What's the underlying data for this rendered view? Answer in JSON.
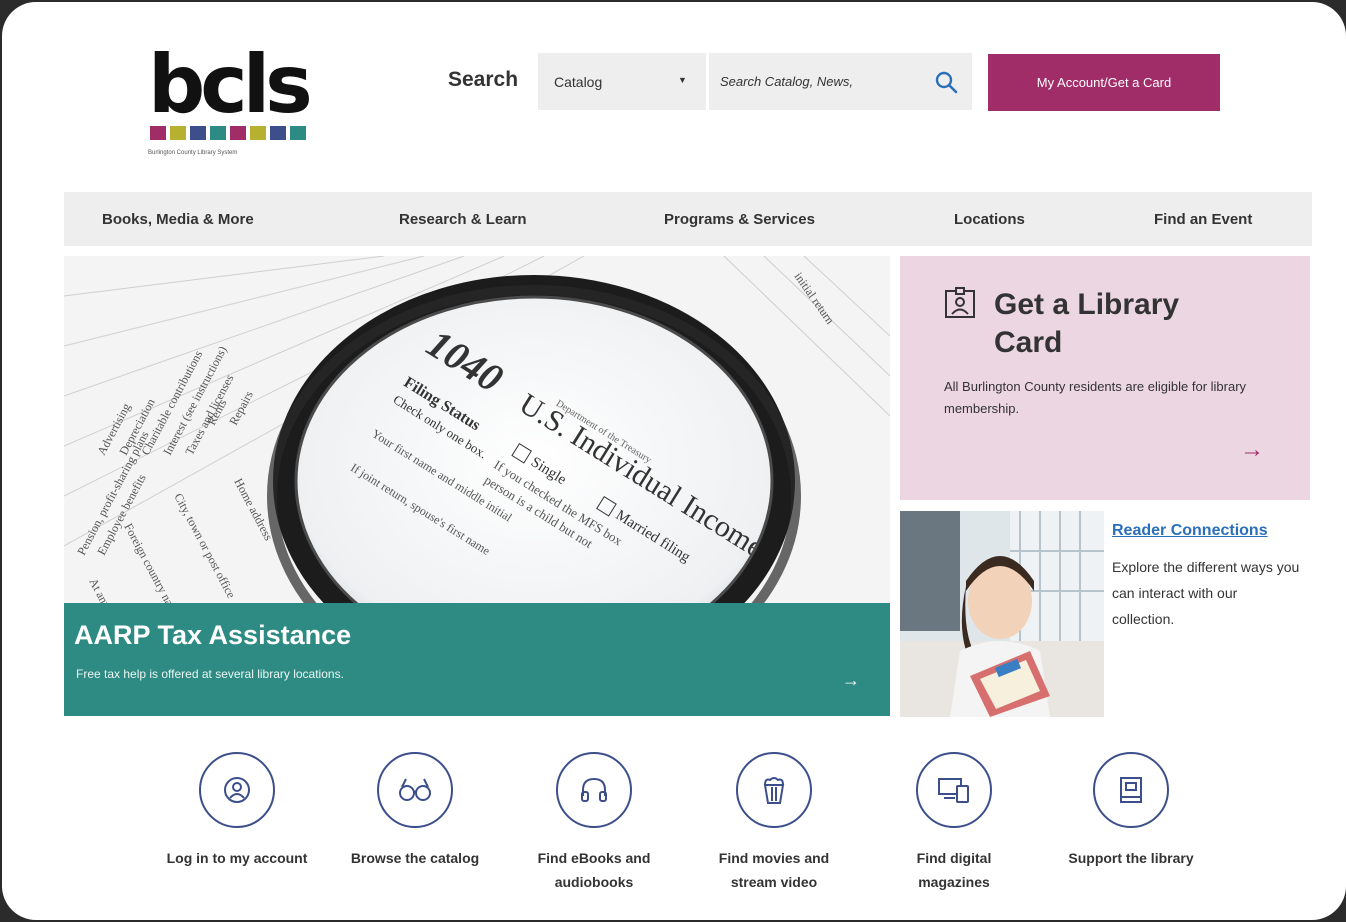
{
  "logo": {
    "word": "bcls",
    "tagline": "Burlington County Library System",
    "square_colors": [
      "#a02c68",
      "#b6b131",
      "#3c4f8a",
      "#2e8b83",
      "#a02c68",
      "#b6b131",
      "#3c4f8a",
      "#2e8b83"
    ]
  },
  "search": {
    "label": "Search",
    "scope_selected": "Catalog",
    "placeholder": "Search Catalog, News,",
    "icon": "magnifier-icon"
  },
  "account_button": {
    "label": "My Account/Get a Card"
  },
  "nav": {
    "items": [
      {
        "label": "Books, Media & More"
      },
      {
        "label": "Research & Learn"
      },
      {
        "label": "Programs & Services"
      },
      {
        "label": "Locations"
      },
      {
        "label": "Find an Event"
      }
    ]
  },
  "hero": {
    "title": "AARP Tax Assistance",
    "subtitle": "Free tax help is offered at several library locations.",
    "arrow": "→",
    "form_number": "1040",
    "form_title": "U.S. Individual Income",
    "filing_status": "Filing Status",
    "check_only": "Check only one box.",
    "single": "Single",
    "married": "Married filing",
    "first_name": "Your first name and middle initial",
    "if_checked": "If you checked the MFS box",
    "a_child": "person is a child but not",
    "joint_return": "If joint return, spouse's first name",
    "home_address": "Home address",
    "city": "City, town or post office",
    "foreign": "Foreign country name",
    "at_any": "At any time",
    "treasury": "Department of the Treasury",
    "form_margin": [
      "Advertising",
      "Depreciation",
      "Charitable contributions",
      "Interest (see instructions)",
      "Taxes and licenses",
      "Rents",
      "Repairs",
      "Pension, profit-sharing plans",
      "Employee benefits"
    ],
    "initial_return": "initial return",
    "color": "#2e8b83"
  },
  "card": {
    "title": "Get a Library Card",
    "body": "All Burlington County residents are eligible for library membership.",
    "arrow": "→",
    "icon": "id-badge-icon",
    "background": "#ecd6e1"
  },
  "reader_connections": {
    "title": "Reader Connections",
    "body": "Explore the different ways you can interact with our collection."
  },
  "quick_links": [
    {
      "label": "Log in to my account",
      "icon": "user-icon"
    },
    {
      "label": "Browse the catalog",
      "icon": "glasses-icon"
    },
    {
      "label": "Find eBooks and audiobooks",
      "icon": "headphones-icon"
    },
    {
      "label": "Find movies and stream video",
      "icon": "popcorn-icon"
    },
    {
      "label": "Find digital magazines",
      "icon": "devices-icon"
    },
    {
      "label": "Support the library",
      "icon": "book-icon"
    }
  ],
  "colors": {
    "accent": "#a02c68",
    "teal": "#2e8b83",
    "navy": "#3c4f8a",
    "link": "#2a6fb8"
  }
}
